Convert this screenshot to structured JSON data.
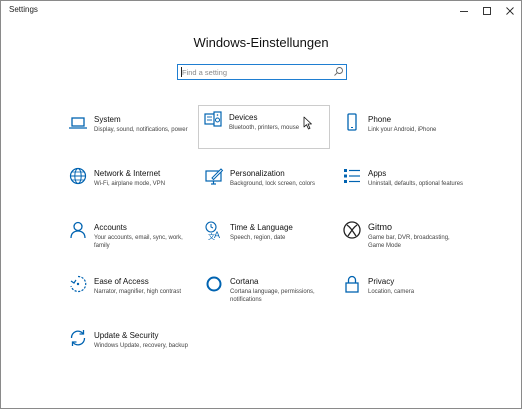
{
  "window": {
    "title": "Settings"
  },
  "heading": "Windows-Einstellungen",
  "search": {
    "placeholder": "Find a setting",
    "value": ""
  },
  "icons": {
    "minimize": "minimize-icon",
    "maximize": "maximize-icon",
    "close": "close-icon",
    "search": "search-icon"
  },
  "colors": {
    "accent": "#0063b1",
    "focus": "#1f7ed1"
  },
  "tiles": [
    {
      "title": "System",
      "subtitle": "Display, sound, notifications, power",
      "icon": "laptop-icon"
    },
    {
      "title": "Devices",
      "subtitle": "Bluetooth, printers, mouse",
      "icon": "keyboard-speaker-icon"
    },
    {
      "title": "Phone",
      "subtitle": "Link your Android, iPhone",
      "icon": "phone-icon"
    },
    {
      "title": "Network & Internet",
      "subtitle": "Wi-Fi, airplane mode, VPN",
      "icon": "globe-icon"
    },
    {
      "title": "Personalization",
      "subtitle": "Background, lock screen, colors",
      "icon": "paint-monitor-icon"
    },
    {
      "title": "Apps",
      "subtitle": "Uninstall, defaults, optional features",
      "icon": "apps-list-icon"
    },
    {
      "title": "Accounts",
      "subtitle": "Your accounts, email, sync, work, family",
      "icon": "person-icon"
    },
    {
      "title": "Time & Language",
      "subtitle": "Speech, region, date",
      "icon": "time-language-icon"
    },
    {
      "title": "Gitmo",
      "subtitle": "Game bar, DVR, broadcasting, Game Mode",
      "icon": "xbox-icon"
    },
    {
      "title": "Ease of Access",
      "subtitle": "Narrator, magnifier, high contrast",
      "icon": "ease-of-access-icon"
    },
    {
      "title": "Cortana",
      "subtitle": "Cortana language, permissions, notifications",
      "icon": "cortana-ring-icon"
    },
    {
      "title": "Privacy",
      "subtitle": "Location, camera",
      "icon": "lock-icon"
    },
    {
      "title": "Update & Security",
      "subtitle": "Windows Update, recovery, backup",
      "icon": "sync-arrows-icon"
    }
  ]
}
